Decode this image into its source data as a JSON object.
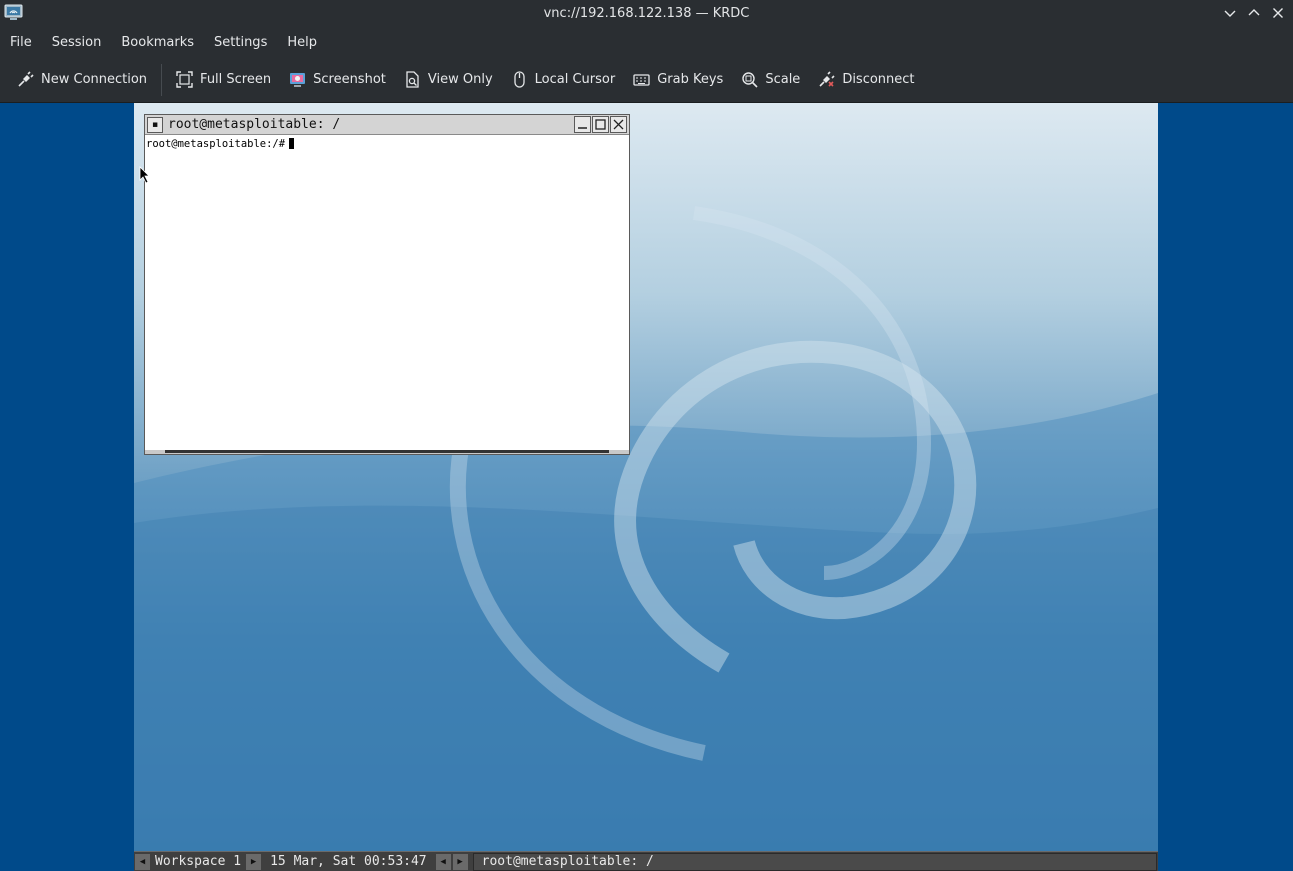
{
  "window": {
    "title": "vnc://192.168.122.138 — KRDC",
    "app_icon": "krdc-app-icon",
    "controls": [
      "minimize-icon",
      "maximize-icon",
      "close-icon"
    ]
  },
  "menubar": {
    "items": [
      "File",
      "Session",
      "Bookmarks",
      "Settings",
      "Help"
    ]
  },
  "toolbar": {
    "new_connection": "New Connection",
    "full_screen": "Full Screen",
    "screenshot": "Screenshot",
    "view_only": "View Only",
    "local_cursor": "Local Cursor",
    "grab_keys": "Grab Keys",
    "scale": "Scale",
    "disconnect": "Disconnect"
  },
  "remote": {
    "xterm": {
      "title": "root@metasploitable: /",
      "prompt": "root@metasploitable:/#"
    },
    "taskbar": {
      "workspace": "Workspace 1",
      "clock": "15 Mar, Sat 00:53:47",
      "task": "root@metasploitable: /"
    }
  },
  "colors": {
    "chrome_bg": "#2a2e32",
    "vnc_bg": "#004a8a",
    "taskbar_bg": "#3f3f3f"
  }
}
